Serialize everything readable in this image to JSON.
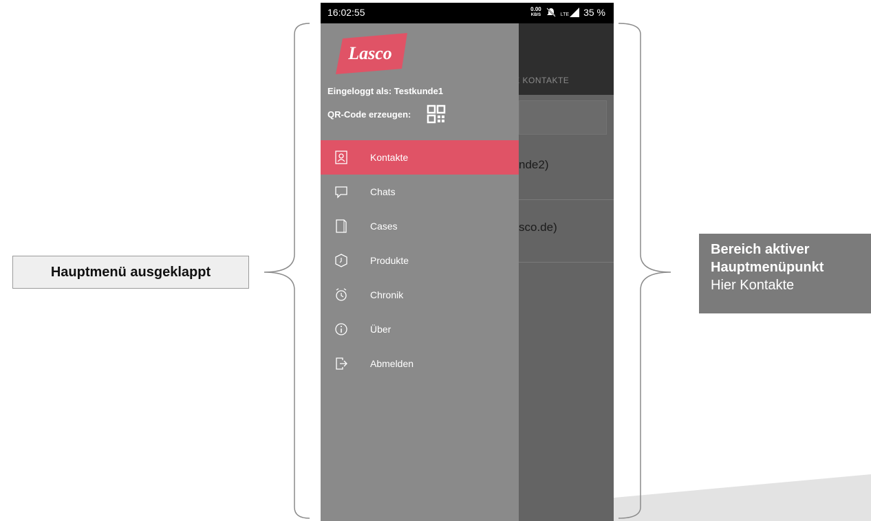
{
  "status_bar": {
    "time": "16:02:55",
    "data_speed_value": "0.00",
    "data_speed_unit": "KB/S",
    "network_label": "LTE",
    "battery": "35 %"
  },
  "app": {
    "tab_partial": "NE KONTAKTE",
    "contacts_partial": [
      "nde2)",
      "sco.de)"
    ]
  },
  "drawer": {
    "logo_text": "Lasco",
    "logged_in": "Eingeloggt als: Testkunde1",
    "qr_label": "QR-Code erzeugen:",
    "active_index": 0,
    "items": [
      {
        "label": "Kontakte",
        "icon": "contact-icon"
      },
      {
        "label": "Chats",
        "icon": "chat-icon"
      },
      {
        "label": "Cases",
        "icon": "cases-icon"
      },
      {
        "label": "Produkte",
        "icon": "product-icon"
      },
      {
        "label": "Chronik",
        "icon": "clock-icon"
      },
      {
        "label": "Über",
        "icon": "info-icon"
      },
      {
        "label": "Abmelden",
        "icon": "logout-icon"
      }
    ]
  },
  "annotations": {
    "left_label": "Hauptmenü ausgeklappt",
    "right_bold_1": "Bereich aktiver",
    "right_bold_2": "Hauptmenüpunkt",
    "right_normal": "Hier Kontakte"
  },
  "colors": {
    "accent": "#e05366",
    "drawer_bg": "#8a8a8a",
    "content_bg": "#646464",
    "appbar": "#2e2e2e",
    "status_bar": "#000000"
  }
}
